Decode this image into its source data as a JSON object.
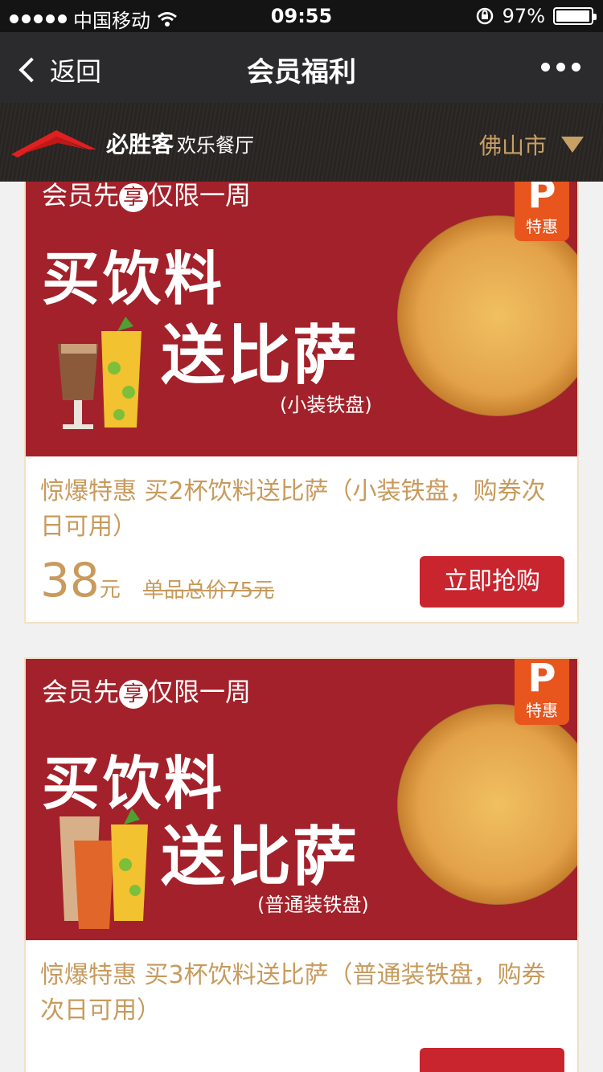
{
  "status": {
    "carrier": "中国移动",
    "time": "09:55",
    "battery": "97%",
    "battery_level": 0.97
  },
  "nav": {
    "back_label": "返回",
    "title": "会员福利"
  },
  "brand": {
    "name": "必胜客",
    "sub": "欢乐餐厅",
    "city": "佛山市"
  },
  "colors": {
    "banner_red": "#a3212a",
    "gold": "#c89a5c",
    "button_red": "#c8252f",
    "tag_orange": "#e8551d"
  },
  "cards": [
    {
      "tag_p": "P",
      "tag_text": "特惠",
      "slogan_a": "会员先",
      "slogan_xiang": "享",
      "slogan_b": "仅限一周",
      "big1": "买饮料",
      "big2": "送比萨",
      "note": "(小装铁盘)",
      "desc": "惊爆特惠 买2杯饮料送比萨（小装铁盘，购券次日可用）",
      "price": "38",
      "unit": "元",
      "orig": "单品总价75元",
      "buy": "立即抢购"
    },
    {
      "tag_p": "P",
      "tag_text": "特惠",
      "slogan_a": "会员先",
      "slogan_xiang": "享",
      "slogan_b": "仅限一周",
      "big1": "买饮料",
      "big2": "送比萨",
      "note": "(普通装铁盘)",
      "desc": "惊爆特惠 买3杯饮料送比萨（普通装铁盘，购券次日可用）",
      "price": "",
      "unit": "",
      "orig": "",
      "buy": ""
    }
  ]
}
